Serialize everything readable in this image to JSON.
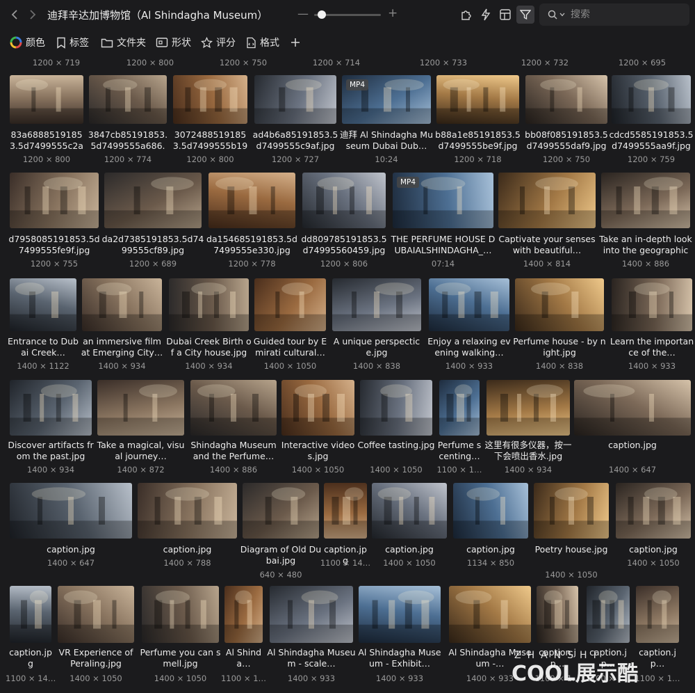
{
  "app": {
    "title": "迪拜辛达加博物馆（Al Shindagha Museum）",
    "search_placeholder": "搜索"
  },
  "toolbar": {
    "zoom_minus": "—",
    "zoom_plus": "+",
    "zoom_level": 0.05
  },
  "filters": [
    {
      "label": "颜色",
      "icon": "color-wheel-icon"
    },
    {
      "label": "标签",
      "icon": "bookmark-icon"
    },
    {
      "label": "文件夹",
      "icon": "folder-icon"
    },
    {
      "label": "形状",
      "icon": "shape-icon"
    },
    {
      "label": "评分",
      "icon": "star-icon"
    },
    {
      "label": "格式",
      "icon": "file-format-icon"
    }
  ],
  "top_sizes": [
    "1200 × 719",
    "1200 × 800",
    "1200 × 750",
    "1200 × 714",
    "1200 × 733",
    "1200 × 732",
    "1200 × 695"
  ],
  "rows": [
    [
      {
        "name": "83a68885191853.5d7499555c2ac…",
        "meta": "1200 × 800"
      },
      {
        "name": "3847cb85191853.5d7499555a686.j…",
        "meta": "1200 × 774"
      },
      {
        "name": "30724885191853.5d7499555b19b…",
        "meta": "1200 × 800"
      },
      {
        "name": "ad4b6a85191853.5d7499555c9af.jpg",
        "meta": "1200 × 727"
      },
      {
        "name": "迪拜 Al Shindagha Museum Dubai Dub…",
        "meta": "10:24",
        "badge": "MP4"
      },
      {
        "name": "b88a1e85191853.5d7499555be9f.jpg",
        "meta": "1200 × 718"
      },
      {
        "name": "bb08f085191853.5d7499555daf9.jpg",
        "meta": "1200 × 750"
      },
      {
        "name": "cdcd5585191853.5d7499555aa9f.jpg",
        "meta": "1200 × 759"
      }
    ],
    [
      {
        "name": "d7958085191853.5d7499555fe9f.jpg",
        "meta": "1200 × 755"
      },
      {
        "name": "da2d7385191853.5d7499555cf89.jpg",
        "meta": "1200 × 689"
      },
      {
        "name": "da154685191853.5d7499555e330.jpg",
        "meta": "1200 × 778"
      },
      {
        "name": "dd809785191853.5d74995560459.jpg",
        "meta": "1200 × 806"
      },
      {
        "name": "THE PERFUME HOUSE DUBAIALSHINDAGHA_…",
        "meta": "07:14",
        "badge": "MP4"
      },
      {
        "name": "Captivate your senses with beautiful…",
        "meta": "1400 × 814"
      },
      {
        "name": "Take an in-depth look into the geographica…",
        "meta": "1400 × 886"
      }
    ],
    [
      {
        "name": "Entrance to Dubai Creek…",
        "meta": "1400 × 1122"
      },
      {
        "name": "an immersive film at Emerging City…",
        "meta": "1400 × 934"
      },
      {
        "name": "Dubai Creek Birth of a City house.jpg",
        "meta": "1400 × 934"
      },
      {
        "name": "Guided tour by Emirati cultural…",
        "meta": "1400 × 1050"
      },
      {
        "name": "A unique perspectice.jpg",
        "meta": "1400 × 838"
      },
      {
        "name": "Enjoy a relaxing evening walking…",
        "meta": "1400 × 933"
      },
      {
        "name": "Perfume house - by night.jpg",
        "meta": "1400 × 838"
      },
      {
        "name": "Learn the importance of the…",
        "meta": "1400 × 933"
      }
    ],
    [
      {
        "name": "Discover artifacts from the past.jpg",
        "meta": "1400 × 934"
      },
      {
        "name": "Take a magical, visual journey…",
        "meta": "1400 × 872"
      },
      {
        "name": "Shindagha Museum and the Perfume…",
        "meta": "1400 × 886"
      },
      {
        "name": "Interactive videos.jpg",
        "meta": "1400 × 1050"
      },
      {
        "name": "Coffee tasting.jpg",
        "meta": "1400 × 1050"
      },
      {
        "name": "Perfume scenting…",
        "meta": "1100 × 1…"
      },
      {
        "name": "这里有很多仪器，按一下会喷出香水.jpg",
        "meta": "1400 × 934"
      },
      {
        "name": "caption.jpg",
        "meta": "1400 × 647"
      }
    ],
    [
      {
        "name": "caption.jpg",
        "meta": "1400 × 647"
      },
      {
        "name": "caption.jpg",
        "meta": "1400 × 788"
      },
      {
        "name": "Diagram of Old Dubai.jpg",
        "meta": "640 × 480"
      },
      {
        "name": "caption.jp g",
        "meta": "1100 × 14…"
      },
      {
        "name": "caption.jpg",
        "meta": "1400 × 1050"
      },
      {
        "name": "caption.jpg",
        "meta": "1134 × 850"
      },
      {
        "name": "Poetry house.jpg",
        "meta": "1400 × 1050"
      },
      {
        "name": "caption.jpg",
        "meta": "1400 × 1050"
      }
    ],
    [
      {
        "name": "caption.jp g",
        "meta": "1100 × 14…"
      },
      {
        "name": "VR Experience of Peraling.jpg",
        "meta": "1400 × 1050"
      },
      {
        "name": "Perfume you can smell.jpg",
        "meta": "1400 × 1050"
      },
      {
        "name": "Al Shinda…",
        "meta": "1100 × 1…"
      },
      {
        "name": "Al Shindagha Museum - scale…",
        "meta": "1400 × 933"
      },
      {
        "name": "Al Shindagha Museum - Exhibit…",
        "meta": "1400 × 933"
      },
      {
        "name": "Al Shindagha Museum -…",
        "meta": "1400 × 933"
      },
      {
        "name": "caption.jp…",
        "meta": "1100 × 1…"
      },
      {
        "name": "caption.jp…",
        "meta": "1100 × 1…"
      },
      {
        "name": "caption.jp…",
        "meta": "1100 × 1…"
      }
    ]
  ],
  "watermark": {
    "line1": "ZHANSHI",
    "line2": "COOL展示酷"
  }
}
